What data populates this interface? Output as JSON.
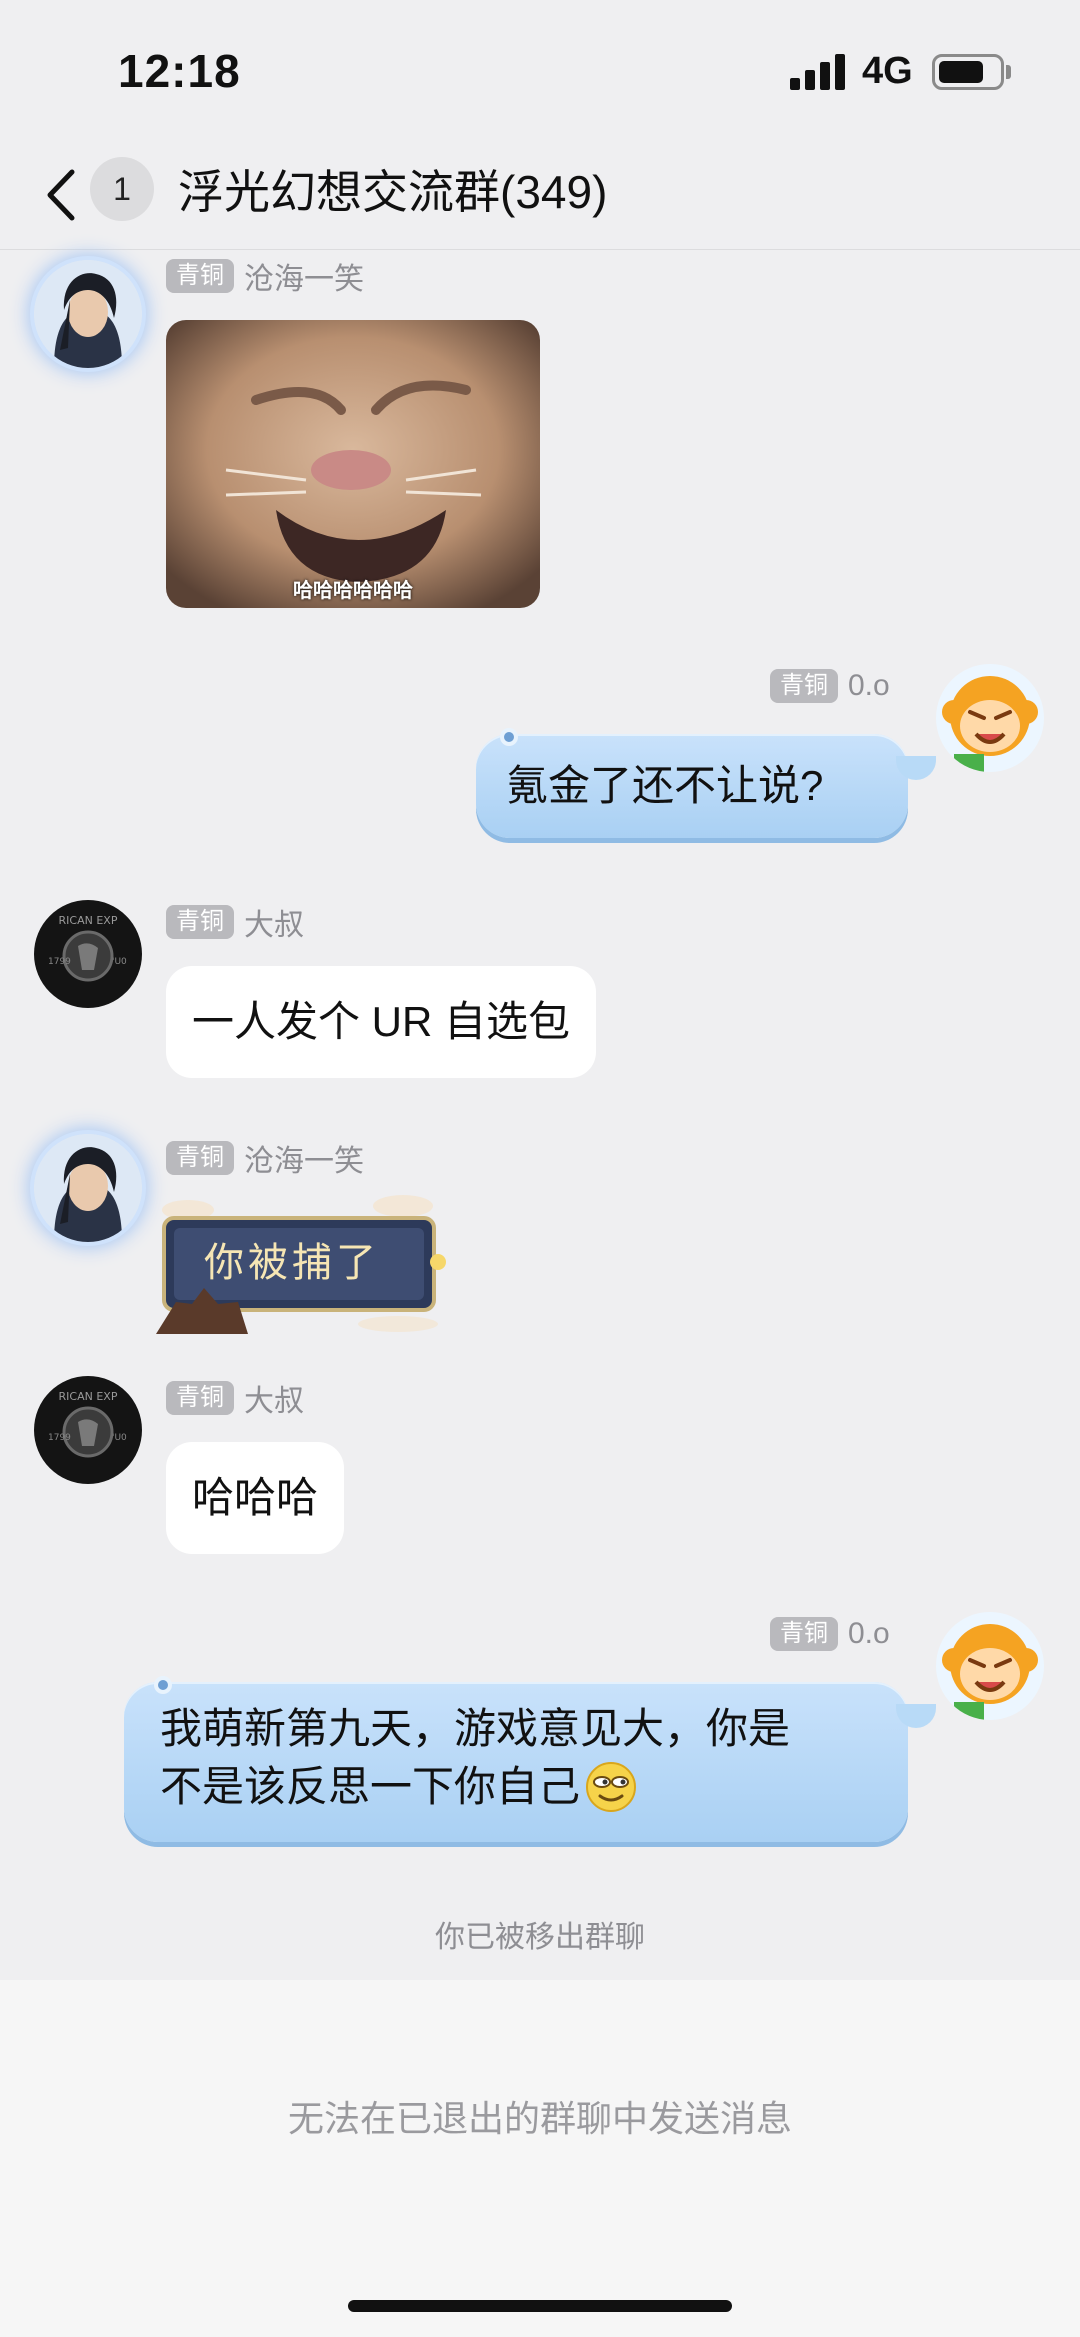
{
  "status_bar": {
    "time": "12:18",
    "network": "4G",
    "battery_level": 0.75
  },
  "nav": {
    "unread_count": "1",
    "title": "浮光幻想交流群(349)"
  },
  "messages": [
    {
      "sender": "沧海一笑",
      "rank": "青铜",
      "type": "image",
      "caption": "哈哈哈哈哈哈"
    },
    {
      "sender": "0.o",
      "rank": "青铜",
      "type": "text",
      "self": true,
      "text": "氪金了还不让说?"
    },
    {
      "sender": "大叔",
      "rank": "青铜",
      "type": "text",
      "text": "一人发个 UR 自选包"
    },
    {
      "sender": "沧海一笑",
      "rank": "青铜",
      "type": "sticker",
      "sticker_text": "你被捕了"
    },
    {
      "sender": "大叔",
      "rank": "青铜",
      "type": "text",
      "text": "哈哈哈"
    },
    {
      "sender": "0.o",
      "rank": "青铜",
      "type": "text",
      "self": true,
      "text_line1": "我萌新第九天，游戏意见大，你是",
      "text_line2": "不是该反思一下你自己",
      "emoji": "smirk-emoji"
    }
  ],
  "system_notice": "你已被移出群聊",
  "input_disabled_hint": "无法在已退出的群聊中发送消息",
  "colors": {
    "background": "#efeff1",
    "self_bubble": "#b8daf7",
    "rank_badge": "#b9b9bd"
  }
}
